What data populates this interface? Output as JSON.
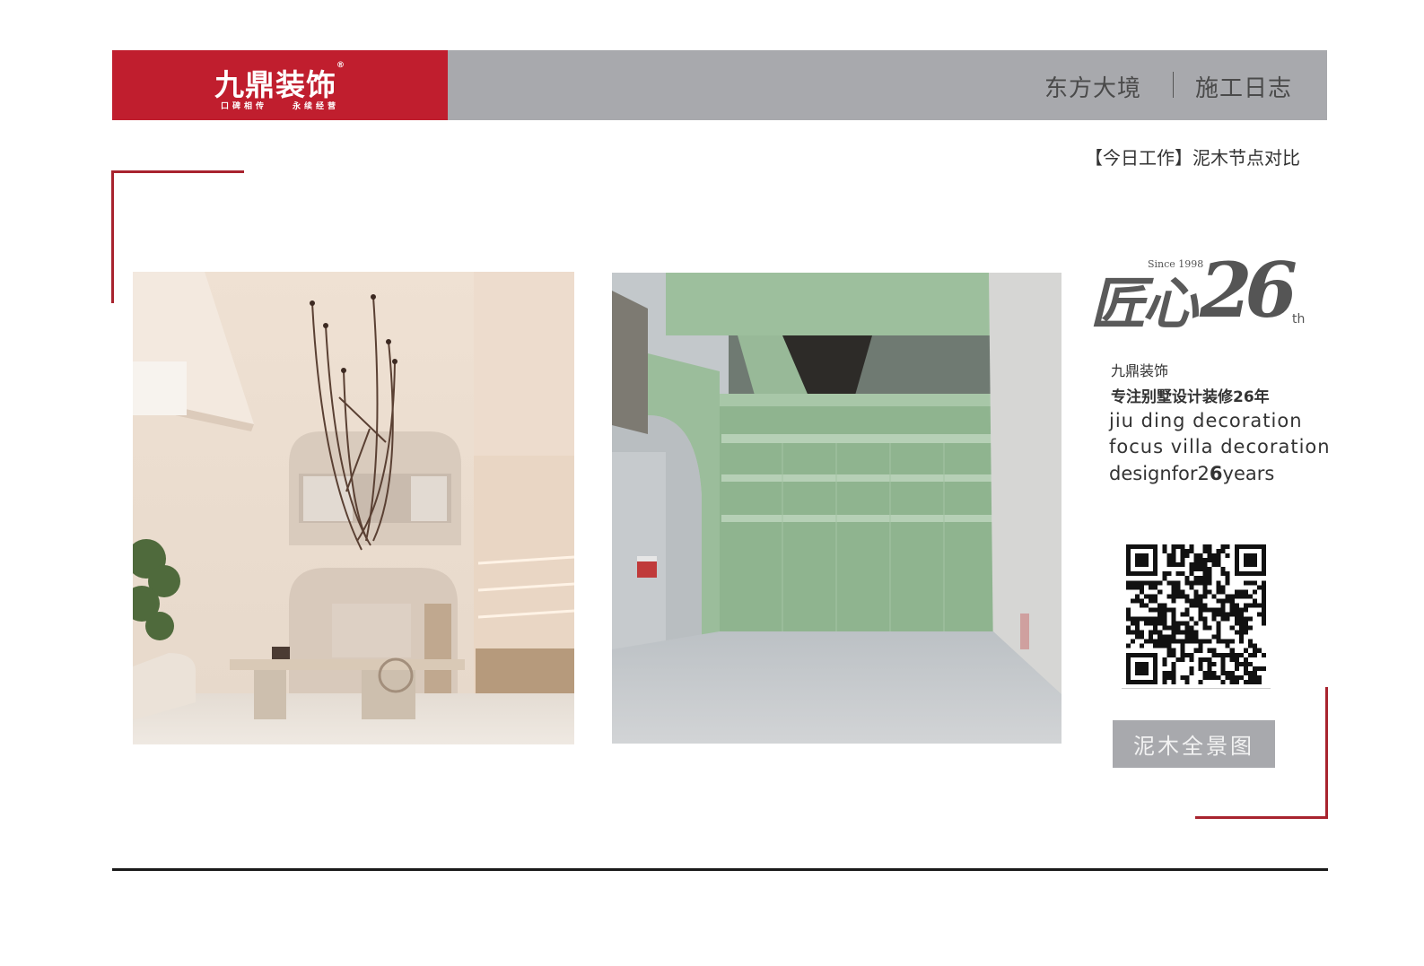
{
  "brand": {
    "name": "九鼎装饰",
    "registered_mark": "®",
    "slogan_left": "口碑相传",
    "slogan_right": "永续经营",
    "color": "#c01e2e"
  },
  "header": {
    "project": "东方大境",
    "section": "施工日志",
    "bar_color": "#a8a9ad"
  },
  "today_work": "【今日工作】泥木节点对比",
  "images": {
    "render": "design-render-photo",
    "site": "construction-site-photo"
  },
  "logo": {
    "since": "Since 1998",
    "chars": "匠心",
    "number": "26",
    "suffix": "th"
  },
  "info": {
    "company": "九鼎装饰",
    "tagline": "专注别墅设计装修26年",
    "en_line1": "jiu ding  decoration",
    "en_line2": "focus  villa  decoration",
    "en_line3_a": "designfor2",
    "en_line3_b": "6",
    "en_line3_c": "years"
  },
  "qr_code": "qr-code",
  "panorama_button": "泥木全景图",
  "accent_color": "#a8232e"
}
